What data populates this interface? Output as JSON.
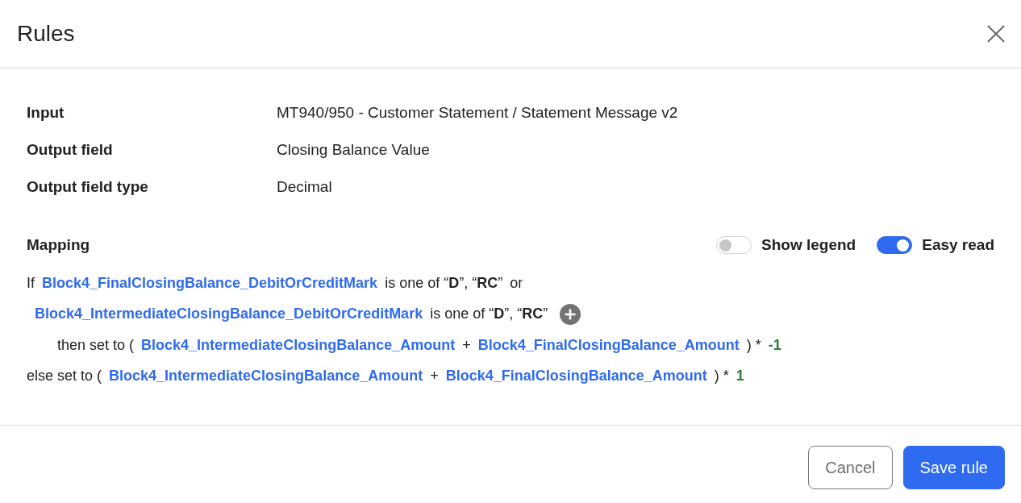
{
  "dialog": {
    "title": "Rules"
  },
  "details": [
    {
      "label": "Input",
      "value": "MT940/950 - Customer Statement / Statement Message v2"
    },
    {
      "label": "Output field",
      "value": "Closing Balance Value"
    },
    {
      "label": "Output field type",
      "value": "Decimal"
    }
  ],
  "mapping": {
    "title": "Mapping",
    "toggles": [
      {
        "label": "Show legend",
        "on": false
      },
      {
        "label": "Easy read",
        "on": true
      }
    ],
    "lines": [
      {
        "kind": "condition",
        "tokens": [
          {
            "kind": "text",
            "text": "If"
          },
          {
            "kind": "field",
            "text": "Block4_FinalClosingBalance_DebitOrCreditMark"
          },
          {
            "kind": "text",
            "text": "is one of “**D**”, “**RC**”"
          },
          {
            "kind": "text",
            "text": "or"
          }
        ]
      },
      {
        "kind": "continuation",
        "tokens": [
          {
            "kind": "field",
            "text": "Block4_IntermediateClosingBalance_DebitOrCreditMark"
          },
          {
            "kind": "text",
            "text": "is one of “**D**”, “**RC**”"
          },
          {
            "kind": "add"
          }
        ]
      },
      {
        "kind": "then",
        "tokens": [
          {
            "kind": "text",
            "text": "then set to ("
          },
          {
            "kind": "field",
            "text": "Block4_IntermediateClosingBalance_Amount"
          },
          {
            "kind": "text",
            "text": "+"
          },
          {
            "kind": "field",
            "text": "Block4_FinalClosingBalance_Amount"
          },
          {
            "kind": "text",
            "text": ") *"
          },
          {
            "kind": "number",
            "text": "-1"
          }
        ]
      },
      {
        "kind": "else",
        "tokens": [
          {
            "kind": "text",
            "text": "else set to ("
          },
          {
            "kind": "field",
            "text": "Block4_IntermediateClosingBalance_Amount"
          },
          {
            "kind": "text",
            "text": "+"
          },
          {
            "kind": "field",
            "text": "Block4_FinalClosingBalance_Amount"
          },
          {
            "kind": "text",
            "text": ") *"
          },
          {
            "kind": "number",
            "text": "1"
          }
        ]
      }
    ]
  },
  "footer": {
    "buttons": [
      {
        "label": "Cancel",
        "kind": "secondary"
      },
      {
        "label": "Save rule",
        "kind": "primary"
      }
    ]
  }
}
